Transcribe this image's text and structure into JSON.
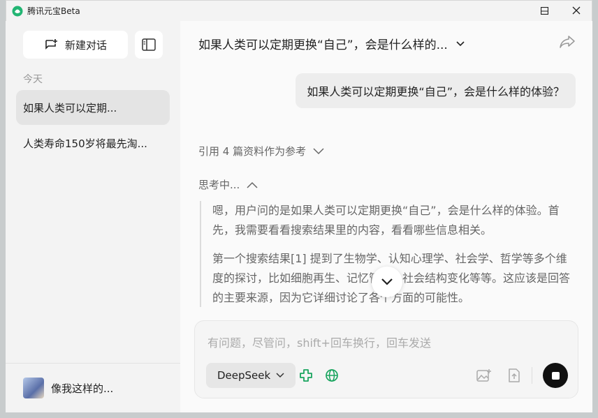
{
  "app": {
    "title": "腾讯元宝Beta"
  },
  "window_controls": {
    "minimize": "—",
    "maximize": "☐",
    "close": "✕"
  },
  "sidebar": {
    "new_chat_label": "新建对话",
    "section_label": "今天",
    "conversations": [
      {
        "label": "如果人类可以定期...",
        "active": true
      },
      {
        "label": "人类寿命150岁将最先淘..."
      }
    ],
    "user_name": "像我这样的..."
  },
  "main": {
    "conversation_title": "如果人类可以定期更换“自己”，会是什么样的...",
    "user_message": "如果人类可以定期更换“自己”，会是什么样的体验？",
    "citation_label": "引用 4 篇资料作为参考",
    "thinking_label": "思考中...",
    "thought_paragraphs": [
      "嗯，用户问的是如果人类可以定期更换“自己”，会是什么样的体验。首先，我需要看看搜索结果里的内容，看看哪些信息相关。",
      "第一个搜索结果[1] 提到了生物学、认知心理学、社会学、哲学等多个维度的探讨，比如细胞再生、记忆管理、社会结构变化等等。这应该是回答的主要来源，因为它详细讨论了各个方面的可能性。"
    ]
  },
  "composer": {
    "placeholder": "有问题，尽管问，shift+回车换行，回车发送",
    "model_label": "DeepSeek"
  },
  "colors": {
    "sidebar_bg": "#f3f3f3",
    "main_bg": "#fafafa",
    "accent_green": "#1aa55f",
    "stop_button": "#111111"
  }
}
